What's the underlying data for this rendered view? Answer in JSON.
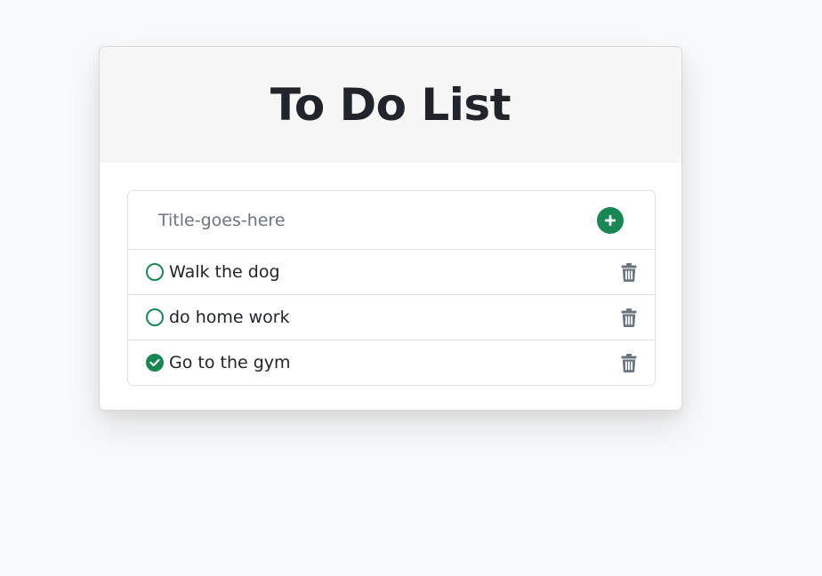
{
  "header": {
    "title": "To Do List"
  },
  "new_item": {
    "placeholder": "Title-goes-here",
    "value": "",
    "add_icon": "plus-circle-icon"
  },
  "todos": [
    {
      "text": "Walk the dog",
      "completed": false
    },
    {
      "text": "do home work",
      "completed": false
    },
    {
      "text": "Go to the gym",
      "completed": true
    }
  ],
  "icons": {
    "unchecked": "circle-icon",
    "checked": "check-circle-icon",
    "delete": "trash-icon"
  },
  "colors": {
    "accent": "#198754",
    "icon_muted": "#6c757d",
    "header_bg": "#f7f7f7",
    "page_bg": "#f8f9fa"
  }
}
